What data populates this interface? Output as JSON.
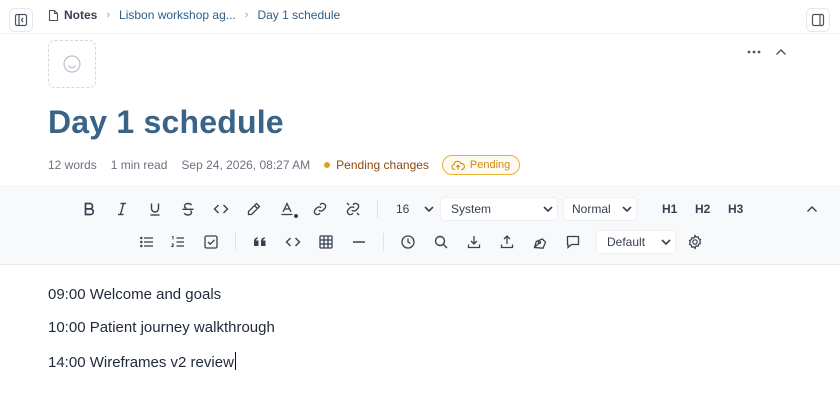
{
  "breadcrumb": {
    "root": "Notes",
    "parent": "Lisbon workshop ag...",
    "current": "Day 1 schedule"
  },
  "page": {
    "title": "Day 1 schedule"
  },
  "meta": {
    "words": "12 words",
    "read_time": "1 min read",
    "timestamp": "Sep 24, 2026, 08:27 AM",
    "pending_changes": "Pending changes",
    "pending_badge": "Pending"
  },
  "toolbar": {
    "font_size": "16",
    "font_family": "System",
    "paragraph_style": "Normal",
    "h1": "H1",
    "h2": "H2",
    "h3": "H3",
    "theme": "Default"
  },
  "content": {
    "lines": [
      "09:00 Welcome and goals",
      "10:00 Patient journey walkthrough",
      "14:00 Wireframes v2 review"
    ]
  },
  "icons": {
    "sidebar_left": "sidebar-left-icon",
    "sidebar_right": "sidebar-right-icon",
    "note": "note-icon",
    "emoji": "smile-icon",
    "more": "more-horizontal-icon",
    "collapse": "chevron-up-icon",
    "cloud": "cloud-upload-icon"
  },
  "colors": {
    "title": "#3a6487",
    "link": "#2f5e87",
    "pending": "#e59e1a",
    "toolbar_bg": "#f8f9fb"
  }
}
